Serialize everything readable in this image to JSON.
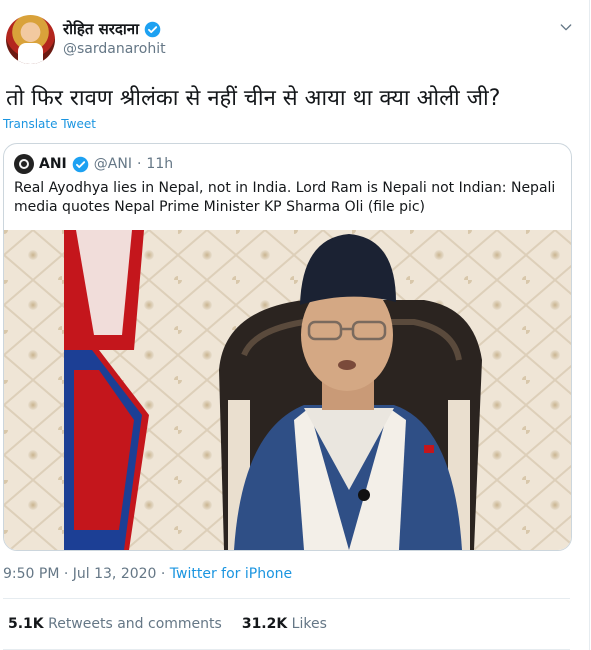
{
  "author": {
    "display_name": "रोहित सरदाना",
    "handle": "@sardanarohit",
    "verified": true
  },
  "tweet": {
    "text": "तो फिर रावण श्रीलंका से नहीं चीन से आया था क्या ओली जी?",
    "translate_label": "Translate Tweet"
  },
  "quoted_tweet": {
    "name": "ANI",
    "handle": "@ANI",
    "separator": "·",
    "age": "11h",
    "text": "Real Ayodhya lies in Nepal, not in India. Lord Ram is Nepali not Indian: Nepali media quotes Nepal Prime Minister KP Sharma Oli (file pic)"
  },
  "footer": {
    "time": "9:50 PM · Jul 13, 2020 · ",
    "source": "Twitter for iPhone"
  },
  "stats": {
    "retweets_count": "5.1K",
    "retweets_label": "Retweets and comments",
    "likes_count": "31.2K",
    "likes_label": "Likes"
  },
  "colors": {
    "link": "#1b95e0",
    "muted": "#657786",
    "border": "#ccd6dd",
    "verified": "#1da1f2"
  },
  "icons": {
    "verified": "verified-badge-icon",
    "menu": "chevron-down-icon"
  }
}
